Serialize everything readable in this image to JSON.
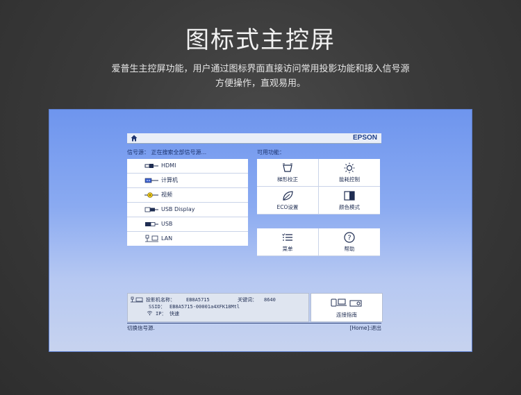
{
  "page": {
    "title": "图标式主控屏",
    "subtitle_line1": "爱普生主控屏功能，用户通过图标界面直接访问常用投影功能和接入信号源",
    "subtitle_line2": "方便操作，直观易用。"
  },
  "screen": {
    "brand": "EPSON",
    "source_label": "信号源： 正在搜索全部信号源...",
    "function_label": "可用功能：",
    "sources": [
      {
        "label": "HDMI",
        "icon": "hdmi-icon"
      },
      {
        "label": "计算机",
        "icon": "computer-port-icon"
      },
      {
        "label": "视频",
        "icon": "video-port-icon"
      },
      {
        "label": "USB Display",
        "icon": "usb-display-icon"
      },
      {
        "label": "USB",
        "icon": "usb-icon"
      },
      {
        "label": "LAN",
        "icon": "lan-icon"
      }
    ],
    "functions": [
      {
        "label": "梯形校正",
        "icon": "keystone-icon"
      },
      {
        "label": "能耗控制",
        "icon": "brightness-icon"
      },
      {
        "label": "ECO设置",
        "icon": "eco-leaf-icon"
      },
      {
        "label": "颜色模式",
        "icon": "color-mode-icon"
      },
      {
        "label": "菜单",
        "icon": "menu-list-icon"
      },
      {
        "label": "帮助",
        "icon": "help-icon"
      }
    ],
    "info": {
      "projector_name_label": "投影机名称：",
      "projector_name": "EB8A5715",
      "keyword_label": "关键词：",
      "keyword": "8640",
      "ssid_label": "SSID：",
      "ssid": "EB8A5715-00001a4XFK18Mtl",
      "ip_label": "IP：",
      "ip": "快速"
    },
    "guide_label": "连接指南",
    "footer_left": "切换信号源.",
    "footer_right": "[Home]:退出",
    "colors": {
      "screen_top": "#6e95ee",
      "screen_bottom": "#c7d3ef",
      "text": "#1f2d52",
      "brand": "#1e3f8a"
    }
  }
}
